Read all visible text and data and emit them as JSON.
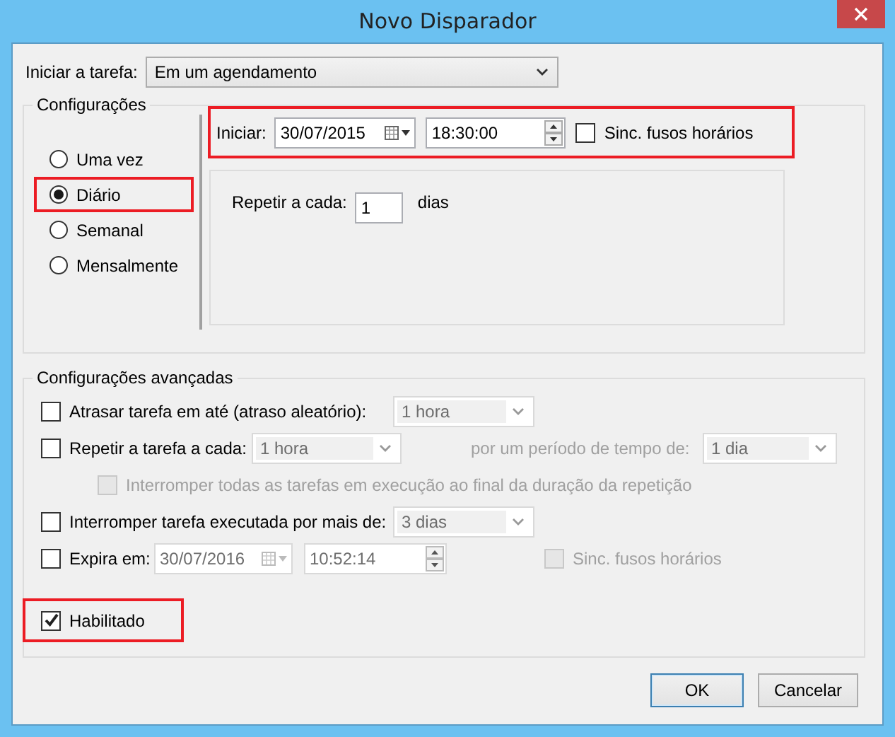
{
  "window": {
    "title": "Novo Disparador"
  },
  "start_task": {
    "label": "Iniciar a tarefa:",
    "value": "Em um agendamento"
  },
  "settings": {
    "title": "Configurações",
    "options": [
      {
        "label": "Uma vez",
        "selected": false,
        "highlighted": false
      },
      {
        "label": "Diário",
        "selected": true,
        "highlighted": true
      },
      {
        "label": "Semanal",
        "selected": false,
        "highlighted": false
      },
      {
        "label": "Mensalmente",
        "selected": false,
        "highlighted": false
      }
    ],
    "start": {
      "label": "Iniciar:",
      "date": "30/07/2015",
      "time": "18:30:00",
      "highlighted": true,
      "sync": {
        "label": "Sinc. fusos horários",
        "checked": false
      }
    },
    "recur": {
      "label": "Repetir a cada:",
      "value": "1",
      "unit": "dias"
    }
  },
  "advanced": {
    "title": "Configurações avançadas",
    "delay": {
      "label": "Atrasar tarefa em até (atraso aleatório):",
      "checked": false,
      "select": {
        "value": "1 hora",
        "disabled": true
      }
    },
    "repeat": {
      "label": "Repetir a tarefa a cada:",
      "checked": false,
      "select": {
        "value": "1 hora",
        "disabled": true
      },
      "duration_label": "por um período de tempo de:",
      "duration_select": {
        "value": "1 dia",
        "disabled": true
      },
      "stop_all": {
        "label": "Interromper todas as tarefas em execução ao final da duração da repetição",
        "checked": false,
        "disabled": true
      }
    },
    "stop_after": {
      "label": "Interromper tarefa executada por mais de:",
      "checked": false,
      "select": {
        "value": "3 dias",
        "disabled": true
      }
    },
    "expire": {
      "label": "Expira em:",
      "checked": false,
      "date": "30/07/2016",
      "time": "10:52:14",
      "disabled": true,
      "sync": {
        "label": "Sinc. fusos horários",
        "checked": false,
        "disabled": true
      }
    },
    "enabled": {
      "label": "Habilitado",
      "checked": true,
      "highlighted": true
    }
  },
  "buttons": [
    {
      "label": "OK",
      "default": true
    },
    {
      "label": "Cancelar",
      "default": false
    }
  ]
}
